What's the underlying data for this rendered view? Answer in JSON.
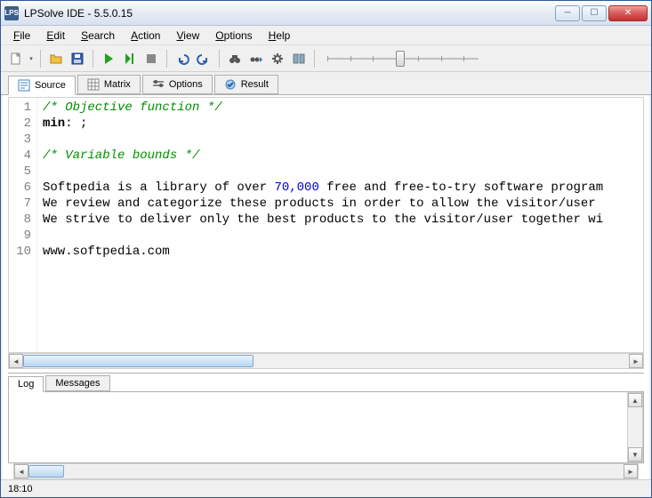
{
  "window": {
    "title": "LPSolve IDE - 5.5.0.15",
    "icon_text": "LPS"
  },
  "menu": {
    "file": "File",
    "edit": "Edit",
    "search": "Search",
    "action": "Action",
    "view": "View",
    "options": "Options",
    "help": "Help"
  },
  "toolbar": {
    "new_icon": "new",
    "open_icon": "open",
    "save_icon": "save",
    "run_icon": "run",
    "step_icon": "step",
    "stop_icon": "stop",
    "undo_icon": "undo",
    "redo_icon": "redo",
    "find_icon": "find",
    "findnext_icon": "find-next",
    "opts_icon": "options",
    "view_icon": "view-toggle"
  },
  "view_tabs": {
    "source": "Source",
    "matrix": "Matrix",
    "options": "Options",
    "result": "Result"
  },
  "code": {
    "lines": [
      "1",
      "2",
      "3",
      "4",
      "5",
      "6",
      "7",
      "8",
      "9",
      "10"
    ],
    "l1": "/* Objective function */",
    "l2a": "min",
    "l2b": ": ;",
    "l4": "/* Variable bounds */",
    "l6a": "Softpedia is a library of over ",
    "l6n": "70,000",
    "l6b": " free and free-to-try software program",
    "l7": "We review and categorize these products in order to allow the visitor/user ",
    "l8": "We strive to deliver only the best products to the visitor/user together wi",
    "l10": "www.softpedia.com"
  },
  "bottom_tabs": {
    "log": "Log",
    "messages": "Messages"
  },
  "status": {
    "pos": "18:10"
  }
}
